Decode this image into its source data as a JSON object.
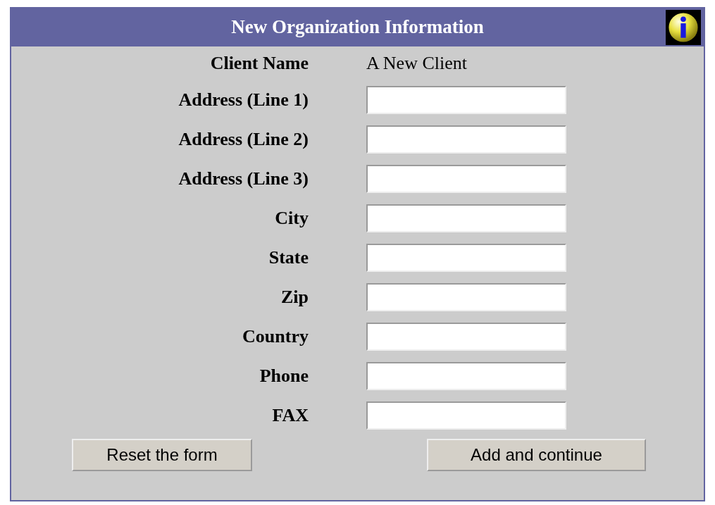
{
  "header": {
    "title": "New Organization Information"
  },
  "client": {
    "label": "Client Name",
    "value": "A New Client"
  },
  "fields": [
    {
      "label": "Address (Line 1)"
    },
    {
      "label": "Address (Line 2)"
    },
    {
      "label": "Address (Line 3)"
    },
    {
      "label": "City"
    },
    {
      "label": "State"
    },
    {
      "label": "Zip"
    },
    {
      "label": "Country"
    },
    {
      "label": "Phone"
    },
    {
      "label": "FAX"
    }
  ],
  "buttons": [
    {
      "label": "Reset the form",
      "kind": "reset"
    },
    {
      "label": "Add and continue",
      "kind": "submit"
    }
  ]
}
